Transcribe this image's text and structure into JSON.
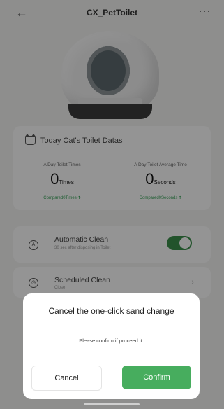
{
  "header": {
    "back_icon": "arrow-left-icon",
    "title": "CX_PetToilet",
    "more_icon": "more-dots-icon"
  },
  "stats": {
    "heading": "Today Cat's Toilet Datas",
    "times": {
      "label": "A Day Toilet Times",
      "value": "0",
      "unit": "Times",
      "compare": "Compared0Times"
    },
    "avg": {
      "label": "A Day Toilet Average Time",
      "value": "0",
      "unit": "Seconds",
      "compare": "Compared0Seconds"
    }
  },
  "auto_clean": {
    "title": "Automatic Clean",
    "subtitle": "30 sec after disposing in Toilet",
    "enabled": true
  },
  "scheduled_clean": {
    "title": "Scheduled Clean",
    "subtitle": "Close"
  },
  "dialog": {
    "title": "Cancel the one-click sand change",
    "message": "Please confirm if proceed it.",
    "cancel_label": "Cancel",
    "confirm_label": "Confirm"
  },
  "colors": {
    "accent_green": "#47ad5e",
    "toggle_on": "#3b8f4b"
  }
}
